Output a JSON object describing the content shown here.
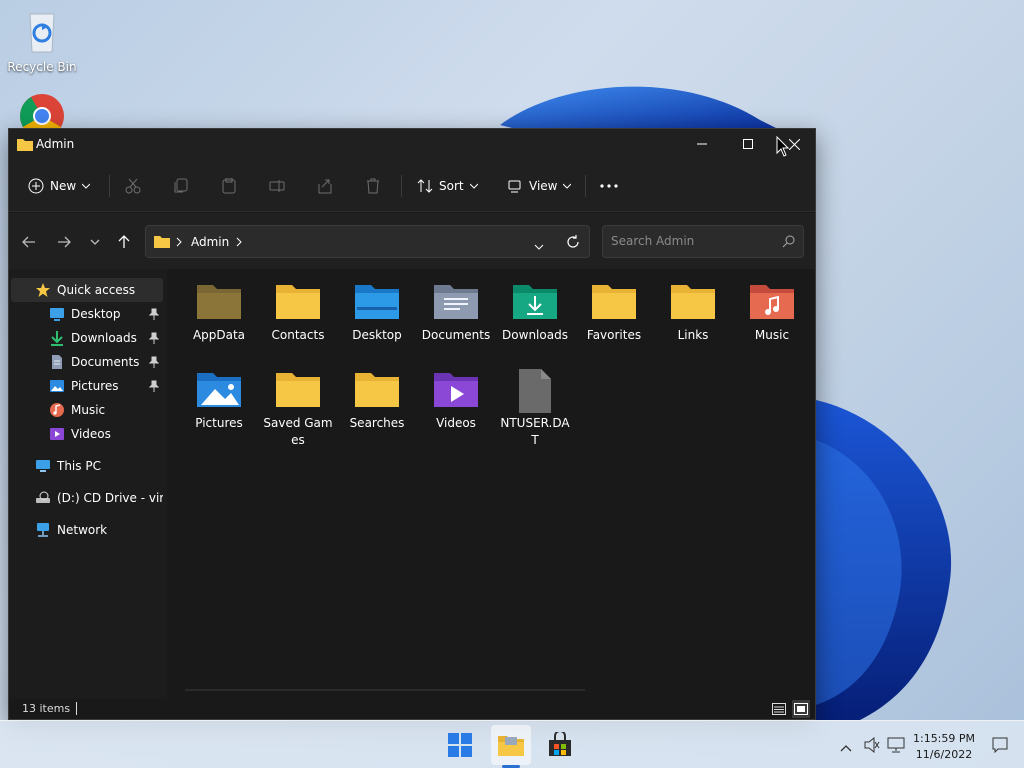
{
  "desktop": {
    "icons": [
      {
        "label": "Recycle Bin",
        "icon": "recycle-bin-icon"
      },
      {
        "label": "Google Chrome",
        "icon": "chrome-icon"
      }
    ]
  },
  "window": {
    "title": "Admin",
    "controls": {
      "minimize": "minimize",
      "maximize": "maximize",
      "close": "close"
    }
  },
  "commandbar": {
    "new_label": "New",
    "sort_label": "Sort",
    "view_label": "View",
    "tools": [
      "cut-icon",
      "copy-icon",
      "paste-icon",
      "rename-icon",
      "share-icon",
      "delete-icon"
    ]
  },
  "address": {
    "crumbs": [
      "Admin"
    ],
    "search_placeholder": "Search Admin"
  },
  "sidebar": {
    "quick_access": "Quick access",
    "items": [
      {
        "label": "Desktop",
        "icon": "desktop-icon",
        "pinned": true
      },
      {
        "label": "Downloads",
        "icon": "downloads-icon",
        "pinned": true
      },
      {
        "label": "Documents",
        "icon": "documents-icon",
        "pinned": true
      },
      {
        "label": "Pictures",
        "icon": "pictures-icon",
        "pinned": true
      },
      {
        "label": "Music",
        "icon": "music-icon",
        "pinned": false
      },
      {
        "label": "Videos",
        "icon": "videos-icon",
        "pinned": false
      }
    ],
    "this_pc": "This PC",
    "cd_drive": "(D:) CD Drive - virtio-win",
    "network": "Network"
  },
  "content": {
    "items": [
      {
        "name": "AppData",
        "icon": "hidden-folder-icon"
      },
      {
        "name": "Contacts",
        "icon": "folder-icon"
      },
      {
        "name": "Desktop",
        "icon": "desktop-folder-icon"
      },
      {
        "name": "Documents",
        "icon": "documents-folder-icon"
      },
      {
        "name": "Downloads",
        "icon": "downloads-folder-icon"
      },
      {
        "name": "Favorites",
        "icon": "folder-icon"
      },
      {
        "name": "Links",
        "icon": "folder-icon"
      },
      {
        "name": "Music",
        "icon": "music-folder-icon"
      },
      {
        "name": "Pictures",
        "icon": "pictures-folder-icon"
      },
      {
        "name": "Saved Games",
        "icon": "folder-icon"
      },
      {
        "name": "Searches",
        "icon": "folder-icon"
      },
      {
        "name": "Videos",
        "icon": "videos-folder-icon"
      },
      {
        "name": "NTUSER.DAT",
        "icon": "file-icon"
      }
    ]
  },
  "status": {
    "item_count": "13 items"
  },
  "taskbar": {
    "apps": [
      "start-icon",
      "file-explorer-icon",
      "store-icon"
    ],
    "time": "1:15:59 PM",
    "date": "11/6/2022"
  },
  "colors": {
    "window_bg": "#191919",
    "chrome_bg": "#202020",
    "folder_yellow": "#f6c744",
    "accent_blue": "#2a6fd1"
  }
}
